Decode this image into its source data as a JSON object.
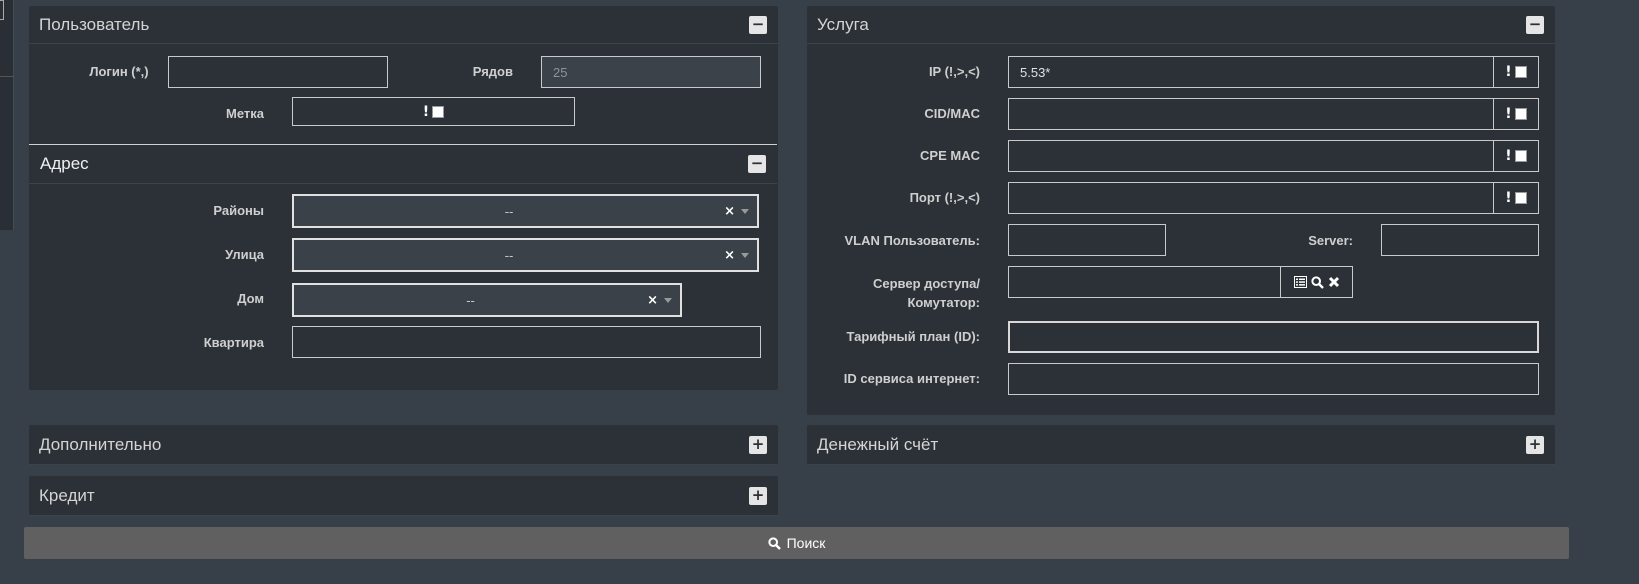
{
  "user_panel": {
    "title": "Пользователь",
    "login_label": "Логин (*,)",
    "login_value": "",
    "rows_label": "Рядов",
    "rows_value": "25",
    "tag_label": "Метка",
    "tag_excl": "!"
  },
  "address_panel": {
    "title": "Адрес",
    "districts_label": "Районы",
    "districts_value": "--",
    "street_label": "Улица",
    "street_value": "--",
    "house_label": "Дом",
    "house_value": "--",
    "apartment_label": "Квартира",
    "apartment_value": "",
    "clear_symbol": "×"
  },
  "service_panel": {
    "title": "Услуга",
    "ip_label": "IP (!,>,<)",
    "ip_value": "5.53*",
    "cid_label": "CID/MAC",
    "cpe_label": "CPE MAC",
    "port_label": "Порт (!,>,<)",
    "vlan_label": "VLAN Пользователь:",
    "server_label": "Server:",
    "access_server_label_1": "Сервер доступа/",
    "access_server_label_2": "Комутатор:",
    "tariff_label": "Тарифный план (ID):",
    "internet_id_label": "ID сервиса интернет:",
    "excl": "!"
  },
  "extra_panel": {
    "title": "Дополнительно"
  },
  "account_panel": {
    "title": "Денежный счёт"
  },
  "credit_panel": {
    "title": "Кредит"
  },
  "toggles": {
    "collapse": "−",
    "expand": "+"
  },
  "search_button": {
    "label": "Поиск"
  }
}
